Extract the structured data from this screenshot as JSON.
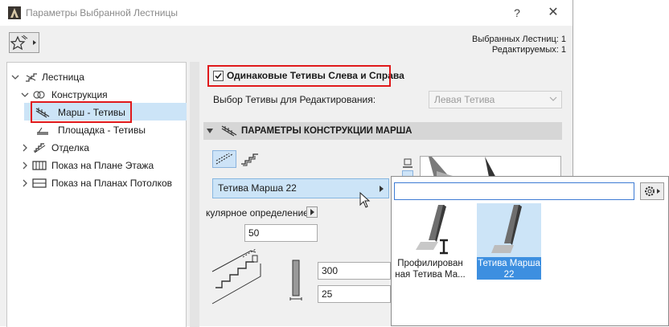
{
  "window": {
    "title": "Параметры Выбранной Лестницы",
    "help": "?",
    "close": "✕"
  },
  "info": {
    "selected": "Выбранных Лестниц: 1",
    "editable": "Редактируемых: 1"
  },
  "tree": {
    "items": [
      {
        "label": "Лестница",
        "icon": "stair-icon"
      },
      {
        "label": "Конструкция",
        "icon": "structure-icon"
      },
      {
        "label": "Марш - Тетивы",
        "icon": "stringer-flight-icon",
        "selected": true
      },
      {
        "label": "Площадка - Тетивы",
        "icon": "stringer-landing-icon"
      },
      {
        "label": "Отделка",
        "icon": "finish-icon"
      },
      {
        "label": "Показ на Плане Этажа",
        "icon": "floor-plan-icon"
      },
      {
        "label": "Показ на Планах Потолков",
        "icon": "ceiling-plan-icon"
      }
    ]
  },
  "panel": {
    "same_stringers_label": "Одинаковые Тетивы Слева и Справа",
    "same_stringers_checked": true,
    "edit_choice_label": "Выбор Тетивы для Редактирования:",
    "edit_choice_value": "Левая Тетива",
    "section_title": "ПАРАМЕТРЫ КОНСТРУКЦИИ МАРША",
    "stringer_dropdown": "Тетива Марша 22",
    "definition_label": "кулярное определение",
    "value_a": "50",
    "value_b": "300",
    "value_c": "25"
  },
  "popup": {
    "search_value": "",
    "tiles": [
      {
        "label_line1": "Профилирован",
        "label_line2": "ная Тетива Ма..."
      },
      {
        "label_line1": "Тетива Марша",
        "label_line2": "22",
        "selected": true
      }
    ]
  },
  "colors": {
    "selection": "#cce4f7",
    "highlight_box": "#e0191b",
    "selected_tile_label": "#3d8fe0"
  }
}
